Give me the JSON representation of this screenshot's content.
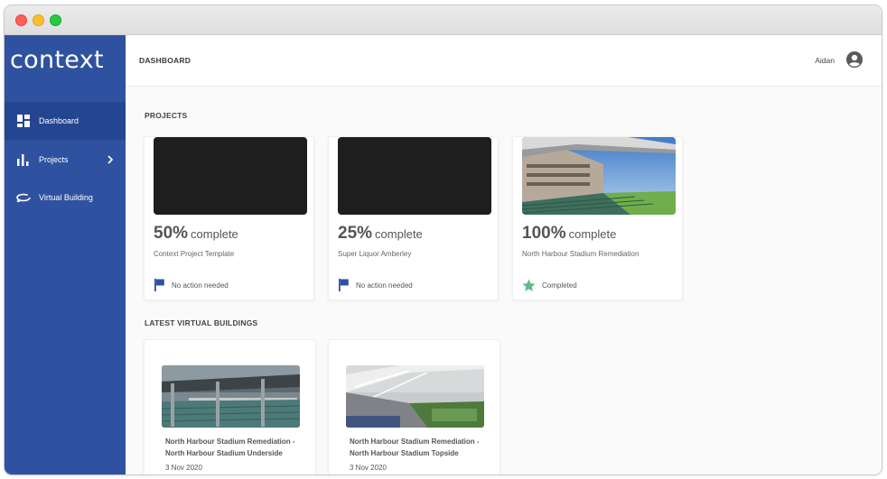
{
  "app": {
    "logo_text": "context"
  },
  "sidebar": {
    "items": [
      {
        "label": "Dashboard",
        "icon": "dashboard-icon",
        "active": true
      },
      {
        "label": "Projects",
        "icon": "bar-chart-icon",
        "has_chevron": true
      },
      {
        "label": "Virtual Building",
        "icon": "rotate-360-icon"
      }
    ]
  },
  "header": {
    "title": "DASHBOARD",
    "user_name": "Aidan"
  },
  "projects": {
    "section_title": "PROJECTS",
    "cards": [
      {
        "percent": "50%",
        "percent_word": "complete",
        "name": "Context Project Template",
        "status": "No action needed",
        "status_icon": "flag-icon"
      },
      {
        "percent": "25%",
        "percent_word": "complete",
        "name": "Super Liquor Amberley",
        "status": "No action needed",
        "status_icon": "flag-icon"
      },
      {
        "percent": "100%",
        "percent_word": "complete",
        "name": "North Harbour Stadium Remediation",
        "status": "Completed",
        "status_icon": "star-icon"
      }
    ]
  },
  "virtual_buildings": {
    "section_title": "LATEST VIRTUAL BUILDINGS",
    "cards": [
      {
        "name": "North Harbour Stadium Remediation - North Harbour Stadium Underside",
        "date": "3 Nov 2020"
      },
      {
        "name": "North Harbour Stadium Remediation - North Harbour Stadium Topside",
        "date": "3 Nov 2020"
      }
    ]
  },
  "colors": {
    "sidebar_bg": "#2f52a0",
    "sidebar_active": "#24458f",
    "flag_blue": "#2f52a0",
    "star_green": "#5fb98a"
  }
}
